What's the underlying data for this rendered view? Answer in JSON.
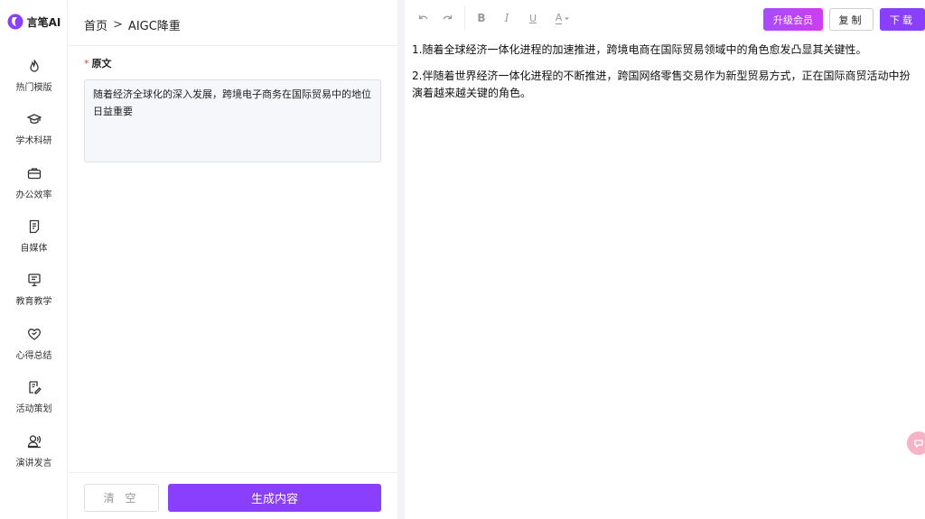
{
  "brand": {
    "name": "言笔AI"
  },
  "sidebar": {
    "items": [
      {
        "label": "热门模版",
        "icon": "fire-icon"
      },
      {
        "label": "学术科研",
        "icon": "graduation-cap-icon"
      },
      {
        "label": "办公效率",
        "icon": "briefcase-icon"
      },
      {
        "label": "自媒体",
        "icon": "document-icon"
      },
      {
        "label": "教育教学",
        "icon": "blackboard-icon"
      },
      {
        "label": "心得总结",
        "icon": "heart-icon"
      },
      {
        "label": "活动策划",
        "icon": "edit-note-icon"
      },
      {
        "label": "演讲发言",
        "icon": "speaker-icon"
      }
    ]
  },
  "breadcrumb": {
    "home": "首页",
    "separator": ">",
    "current": "AIGC降重"
  },
  "form": {
    "required_mark": "*",
    "source_label": "原文",
    "source_value": "随着经济全球化的深入发展，跨境电子商务在国际贸易中的地位日益重要"
  },
  "actions": {
    "clear_label": "清 空",
    "generate_label": "生成内容"
  },
  "editor": {
    "toolbar": {
      "undo_icon": "undo-icon",
      "redo_icon": "redo-icon",
      "bold_label": "B",
      "italic_label": "I",
      "underline_label": "U",
      "font_color_label": "A"
    },
    "upgrade_label": "升级会员",
    "copy_label": "复制",
    "download_label": "下载",
    "paragraphs": [
      "1.随着全球经济一体化进程的加速推进，跨境电商在国际贸易领域中的角色愈发凸显其关键性。",
      "2.伴随着世界经济一体化进程的不断推进，跨国网络零售交易作为新型贸易方式，正在国际商贸活动中扮演着越来越关键的角色。"
    ]
  },
  "colors": {
    "accent": "#8a3ffc",
    "upgrade_gradient_end": "#d13cf0",
    "bubble": "#f7b3c6"
  }
}
